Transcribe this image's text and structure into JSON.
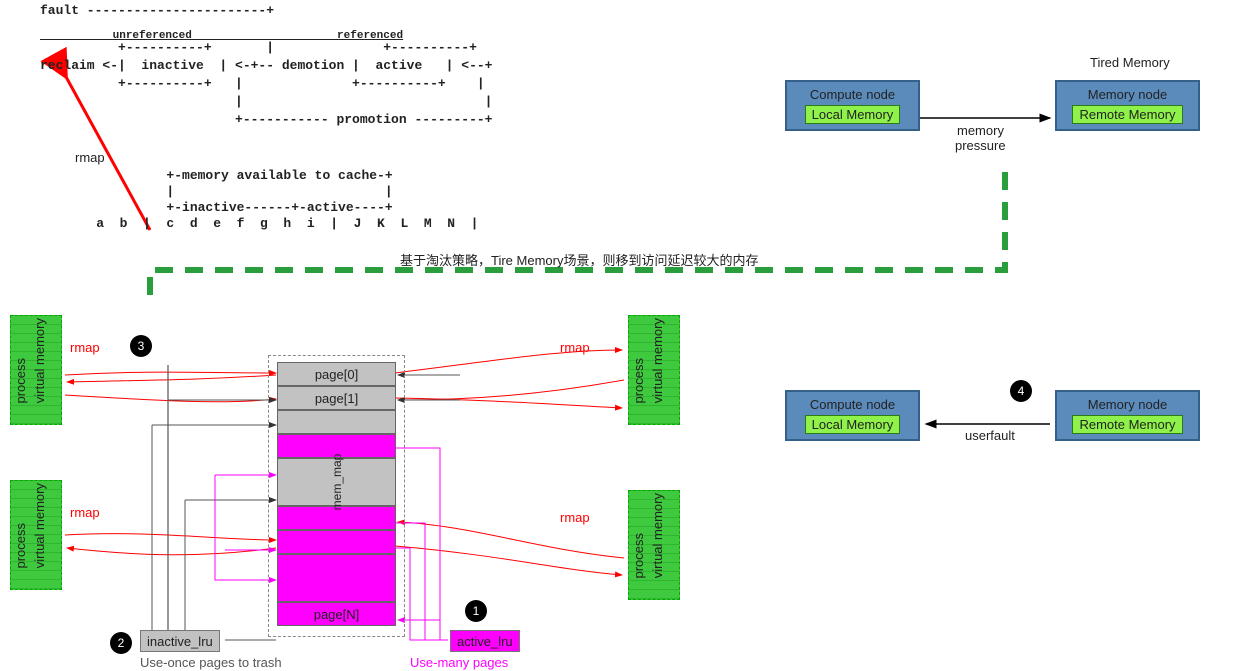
{
  "ascii": {
    "line1": "fault -----------------------+",
    "line2": "          +----------+       |              +----------+",
    "line2u": "           unreferenced                      referenced",
    "line3": "reclaim <-|  inactive  | <-+-- demotion |  active   | <--+",
    "line4": "          +----------+   |              +----------+    |",
    "line5": "                         |                               |",
    "line6": "                         +----------- promotion ---------+",
    "cache1": "             +-memory available to cache-+",
    "cache2": "             |                           |",
    "cache3": "             +-inactive------+-active----+",
    "cache4": "    a  b  |  c  d  e  f  g  h  i  |  J  K  L  M  N  |"
  },
  "labels": {
    "rmap_arrow": "rmap",
    "rmap1": "rmap",
    "rmap2": "rmap",
    "rmap3": "rmap",
    "rmap4": "rmap",
    "process": "process",
    "virtual_memory": "virtual memory",
    "mem_map": "mem_map",
    "page0": "page[0]",
    "page1": "page[1]",
    "pageN": "page[N]",
    "inactive_lru": "inactive_lru",
    "active_lru": "active_lru",
    "use_once": "Use-once pages to trash",
    "use_many": "Use-many pages",
    "tired_memory": "Tired Memory",
    "compute_node": "Compute node",
    "memory_node": "Memory node",
    "local_memory": "Local Memory",
    "remote_memory": "Remote Memory",
    "memory_pressure1": "memory",
    "memory_pressure2": "pressure",
    "userfault": "userfault",
    "chinese": "基于淘汰策略，Tire Memory场景，则移到访问延迟较大的内存"
  },
  "badges": {
    "b1": "1",
    "b2": "2",
    "b3": "3",
    "b4": "4"
  }
}
